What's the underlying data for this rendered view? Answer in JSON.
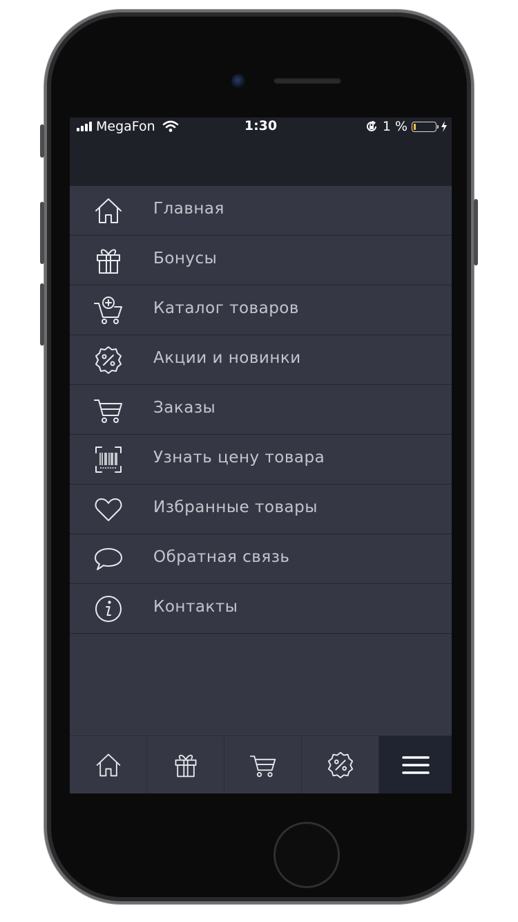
{
  "status_bar": {
    "carrier": "MegaFon",
    "time": "1:30",
    "battery_percent": "1 %",
    "battery_level": 0.01,
    "battery_fill_color": "#f1c232"
  },
  "menu": {
    "items": [
      {
        "label": "Главная",
        "icon": "home-icon"
      },
      {
        "label": "Бонусы",
        "icon": "gift-icon"
      },
      {
        "label": "Каталог товаров",
        "icon": "cart-plus-icon"
      },
      {
        "label": "Акции и новинки",
        "icon": "discount-badge-icon"
      },
      {
        "label": "Заказы",
        "icon": "cart-icon"
      },
      {
        "label": "Узнать цену товара",
        "icon": "barcode-scan-icon"
      },
      {
        "label": "Избранные товары",
        "icon": "heart-icon"
      },
      {
        "label": "Обратная связь",
        "icon": "chat-bubble-icon"
      },
      {
        "label": "Контакты",
        "icon": "info-icon"
      }
    ]
  },
  "tab_bar": {
    "tabs": [
      {
        "icon": "home-icon",
        "active": false
      },
      {
        "icon": "gift-icon",
        "active": false
      },
      {
        "icon": "cart-icon",
        "active": false
      },
      {
        "icon": "discount-badge-icon",
        "active": false
      },
      {
        "icon": "hamburger-menu-icon",
        "active": true
      }
    ]
  },
  "colors": {
    "screen_background": "#353844",
    "header_background": "#1f2129",
    "menu_text": "#c3c5cd",
    "active_tab": "#202330"
  }
}
